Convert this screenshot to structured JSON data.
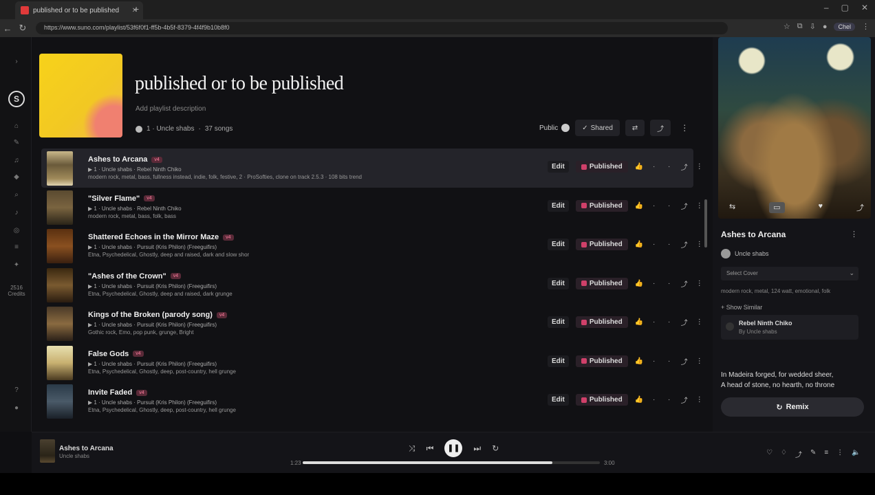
{
  "browser": {
    "tab_title": "published or to be published",
    "tab_close": "✕",
    "new_tab": "+",
    "url": "https://www.suno.com/playlist/53f6f0f1-ff5b-4b5f-8379-4f4f9b10b8f0",
    "profile_label": "Chel"
  },
  "left_nav": {
    "logo": "S",
    "credits_top": "2516",
    "credits_bottom": "Credits"
  },
  "playlist": {
    "title": "published or to be published",
    "description": "Add playlist description",
    "owner": "1 · Uncle shabs",
    "song_count": "37 songs",
    "public_label": "Public",
    "shared_label": "Shared"
  },
  "tracks": [
    {
      "title": "Ashes to Arcana",
      "badge": "v4",
      "sub": "▶ 1 · Uncle shabs · Rebel Ninth Chiko",
      "tags": "modern rock, metal, bass, fullness instead, indie, folk, festive, 2 · ProSofties, clone on track 2.5.3 · 108 bits trend",
      "edit": "Edit",
      "pub": "Published",
      "active": true,
      "thumb": "linear-gradient(180deg,#c9b88a,#6a5a3a 40%,#a08a5a 80%,#e0d4b0)"
    },
    {
      "title": "\"Silver Flame\"",
      "badge": "v4",
      "sub": "▶ 1 · Uncle shabs · Rebel Ninth Chiko",
      "tags": "modern rock, metal, bass, folk, bass",
      "edit": "Edit",
      "pub": "Published",
      "active": false,
      "thumb": "linear-gradient(180deg,#5a4a30,#7a6440 50%,#2a2418)"
    },
    {
      "title": "Shattered Echoes in the Mirror Maze",
      "badge": "v4",
      "sub": "▶ 1 · Uncle shabs · Pursuit (Kris Philon) (Freeguifirs)",
      "tags": "Etna, Psychedelical, Ghostly, deep and raised, dark and slow shor",
      "edit": "Edit",
      "pub": "Published",
      "active": false,
      "thumb": "linear-gradient(180deg,#5a3010,#8a5020 50%,#3a2010)"
    },
    {
      "title": "\"Ashes of the Crown\"",
      "badge": "v4",
      "sub": "▶ 1 · Uncle shabs · Pursuit (Kris Philon) (Freeguifirs)",
      "tags": "Etna, Psychedelical, Ghostly, deep and raised, dark grunge",
      "edit": "Edit",
      "pub": "Published",
      "active": false,
      "thumb": "linear-gradient(180deg,#3a2810,#7a5a30 50%,#2a1c10)"
    },
    {
      "title": "Kings of the Broken (parody song)",
      "badge": "v4",
      "sub": "▶ 1 · Uncle shabs · Pursuit (Kris Philon) (Freeguifirs)",
      "tags": "Gothic rock, Emo, pop punk, grunge, Bright",
      "edit": "Edit",
      "pub": "Published",
      "active": false,
      "thumb": "linear-gradient(180deg,#4a3a28,#8a6a40 50%,#2a2018)"
    },
    {
      "title": "False Gods",
      "badge": "v4",
      "sub": "▶ 1 · Uncle shabs · Pursuit (Kris Philon) (Freeguifirs)",
      "tags": "Etna, Psychedelical, Ghostly, deep, post-country, hell grunge",
      "edit": "Edit",
      "pub": "Published",
      "active": false,
      "thumb": "linear-gradient(180deg,#e8e0b0,#c8b070 50%,#4a3a20)"
    },
    {
      "title": "Invite Faded",
      "badge": "v4",
      "sub": "▶ 1 · Uncle shabs · Pursuit (Kris Philon) (Freeguifirs)",
      "tags": "Etna, Psychedelical, Ghostly, deep, post-country, hell grunge",
      "edit": "Edit",
      "pub": "Published",
      "active": false,
      "thumb": "linear-gradient(180deg,#2a3a48,#4a5a68 50%,#1a2028)"
    }
  ],
  "right_panel": {
    "song_title": "Ashes to Arcana",
    "more": "⋮",
    "artist": "Uncle shabs",
    "select_label": "Select Cover",
    "tags": "modern rock, metal, 124 watt, emotional, folk",
    "show_similar": "+ Show Similar",
    "card_title": "Rebel Ninth Chiko",
    "card_sub": "By Uncle shabs",
    "lyrics_line1": "In Madeira forged, for wedded sheer,",
    "lyrics_line2": "A head of stone, no hearth, no throne",
    "remix_label": "Remix"
  },
  "player": {
    "song": "Ashes to Arcana",
    "artist": "Uncle shabs",
    "time_current": "1:23",
    "time_total": "3:00",
    "progress": 0.84
  },
  "colors": {
    "accent": "#d0406a",
    "background": "#111114",
    "active_row": "#24242a"
  }
}
